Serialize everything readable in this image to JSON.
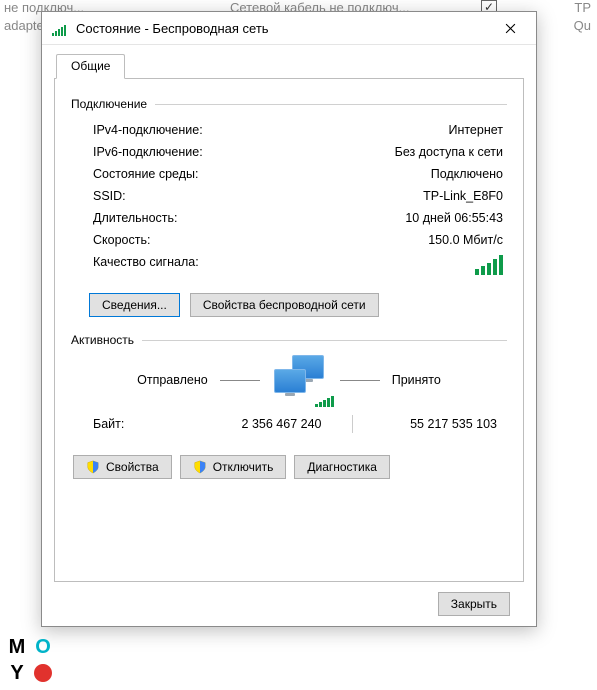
{
  "background": {
    "text_top_left": "не подключ...",
    "text_left_2": "adapte",
    "text_top_center": "Сетевой кабель не подключ...",
    "text_top_right_1": "TP",
    "text_top_right_2": "Qu"
  },
  "window": {
    "title": "Состояние - Беспроводная сеть",
    "tab_general": "Общие"
  },
  "connection": {
    "group_label": "Подключение",
    "ipv4_label": "IPv4-подключение:",
    "ipv4_value": "Интернет",
    "ipv6_label": "IPv6-подключение:",
    "ipv6_value": "Без доступа к сети",
    "media_label": "Состояние среды:",
    "media_value": "Подключено",
    "ssid_label": "SSID:",
    "ssid_value": "TP-Link_E8F0",
    "duration_label": "Длительность:",
    "duration_value": "10 дней 06:55:43",
    "speed_label": "Скорость:",
    "speed_value": "150.0 Мбит/с",
    "signal_label": "Качество сигнала:",
    "details_button": "Сведения...",
    "wireless_props_button": "Свойства беспроводной сети"
  },
  "activity": {
    "group_label": "Активность",
    "sent_label": "Отправлено",
    "received_label": "Принято",
    "bytes_label": "Байт:",
    "bytes_sent": "2 356 467 240",
    "bytes_received": "55 217 535 103",
    "properties_button": "Свойства",
    "disable_button": "Отключить",
    "diagnose_button": "Диагностика"
  },
  "footer": {
    "close_button": "Закрыть"
  },
  "logo": {
    "m": "M",
    "o": "O",
    "y": "Y"
  }
}
